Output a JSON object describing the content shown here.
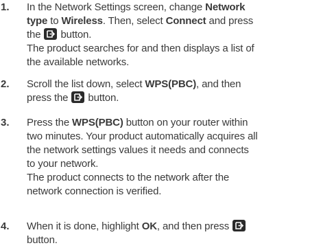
{
  "steps": [
    {
      "number": "1.",
      "lines": [
        {
          "t1": "In the Network Settings screen, change ",
          "b1": "Network"
        },
        {
          "b1": "type",
          "t1": " to ",
          "b2": "Wireless",
          "t2": ". Then, select ",
          "b3": "Connect",
          "t3": " and press"
        },
        {
          "t1": "the ",
          "icon": "enter-button-icon",
          "t2": " button."
        },
        {
          "t1": "The product searches for and then displays a list of"
        },
        {
          "t1": "the available networks."
        }
      ]
    },
    {
      "number": "2.",
      "lines": [
        {
          "t1": "Scroll the list down, select ",
          "b1": "WPS(PBC)",
          "t2": ", and then"
        },
        {
          "t1": "press the ",
          "icon": "enter-button-icon",
          "t2": " button."
        }
      ]
    },
    {
      "number": "3.",
      "lines": [
        {
          "t1": "Press the ",
          "b1": "WPS(PBC)",
          "t2": " button on your router within"
        },
        {
          "t1": "two minutes. Your product automatically acquires all"
        },
        {
          "t1": "the network settings values it needs and connects"
        },
        {
          "t1": "to your network."
        },
        {
          "t1": "The product connects to the network after the"
        },
        {
          "t1": "network connection is verified."
        }
      ]
    },
    {
      "number": "4.",
      "lines": [
        {
          "t1": "When it is done, highlight ",
          "b1": "OK",
          "t2": ", and then press ",
          "icon": "enter-button-icon"
        },
        {
          "t1": "button."
        }
      ]
    }
  ]
}
